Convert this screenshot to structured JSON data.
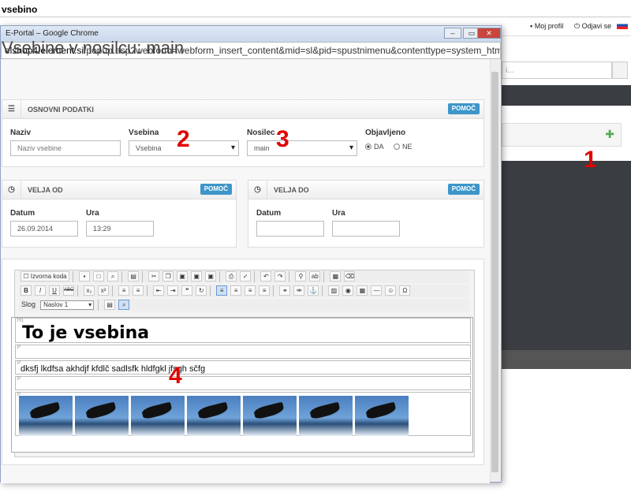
{
  "background": {
    "title": "vsebino",
    "topbar_items": [
      "Moj profil",
      "Odjavi se"
    ],
    "search_placeholder": "i..."
  },
  "window": {
    "title": "E-Portal – Google Chrome",
    "url_domain": "elshop4.element.si",
    "url_path": "/popup.asp?webform=webform_insert_content&mid=sl&pid=spustnimenu&contenttype=system_html&placeho"
  },
  "page_title": "Vsebine v nosilcu: main",
  "basic": {
    "header": "OSNOVNI PODATKI",
    "help": "POMOČ",
    "naziv_label": "Naziv",
    "naziv_placeholder": "Naziv vsebine",
    "vsebina_label": "Vsebina",
    "vsebina_value": "Vsebina",
    "nosilec_label": "Nosilec",
    "nosilec_value": "main",
    "objavljeno_label": "Objavljeno",
    "radio_da": "DA",
    "radio_ne": "NE",
    "radio_selected": "DA"
  },
  "valid_from": {
    "header": "VELJA OD",
    "help": "POMOČ",
    "datum_label": "Datum",
    "datum_value": "26.09.2014",
    "ura_label": "Ura",
    "ura_value": "13:29"
  },
  "valid_to": {
    "header": "VELJA DO",
    "help": "POMOČ",
    "datum_label": "Datum",
    "ura_label": "Ura"
  },
  "editor": {
    "source_label": "Izvorna koda",
    "style_label": "Slog",
    "style_value": "Naslov 1",
    "heading_tag": "H1",
    "heading": "To je vsebina",
    "p_tag": "P",
    "paragraph": "dksfj lkdfsa akhdjf kfdlč sadlsfk hldfgkl jfsgh sčfg",
    "image_count": 7
  },
  "annotations": [
    "1",
    "2",
    "3",
    "4"
  ]
}
